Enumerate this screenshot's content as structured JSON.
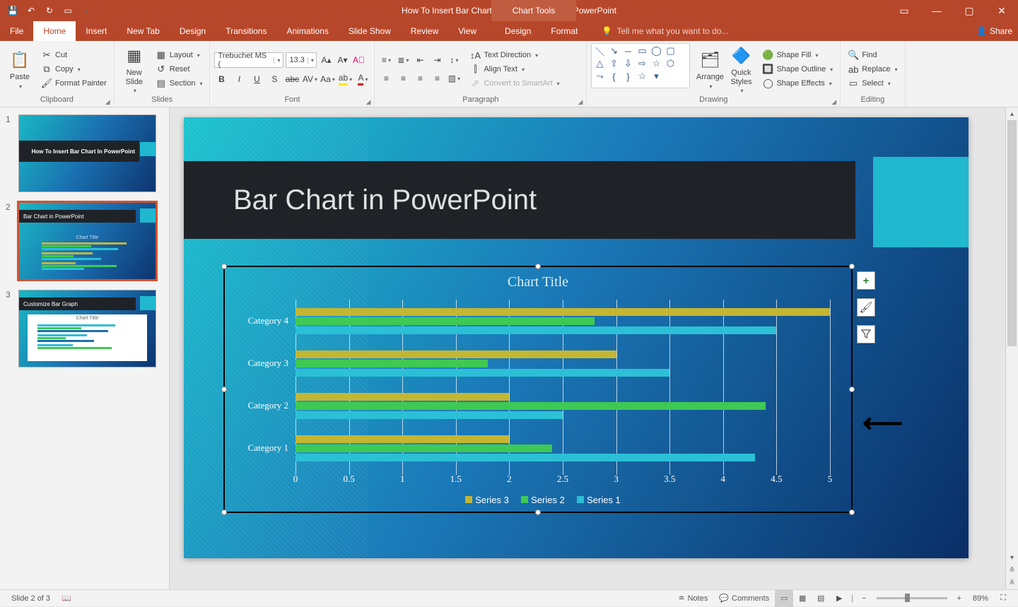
{
  "app": {
    "doc_title": "How To Insert Bar Chart In PowerPoint.pptx - PowerPoint",
    "contextual_tab_group": "Chart Tools",
    "share": "Share",
    "tell_me": "Tell me what you want to do..."
  },
  "tabs": [
    "File",
    "Home",
    "Insert",
    "New Tab",
    "Design",
    "Transitions",
    "Animations",
    "Slide Show",
    "Review",
    "View",
    "Design",
    "Format"
  ],
  "active_tab": 1,
  "ribbon": {
    "clipboard": {
      "label": "Clipboard",
      "paste": "Paste",
      "cut": "Cut",
      "copy": "Copy",
      "format_painter": "Format Painter"
    },
    "slides": {
      "label": "Slides",
      "new_slide": "New\nSlide",
      "layout": "Layout",
      "reset": "Reset",
      "section": "Section"
    },
    "font": {
      "label": "Font",
      "font_name": "Trebuchet MS (",
      "font_size": "13.3"
    },
    "paragraph": {
      "label": "Paragraph",
      "text_direction": "Text Direction",
      "align_text": "Align Text",
      "convert_smartart": "Convert to SmartArt"
    },
    "drawing": {
      "label": "Drawing",
      "arrange": "Arrange",
      "quick_styles": "Quick\nStyles",
      "shape_fill": "Shape Fill",
      "shape_outline": "Shape Outline",
      "shape_effects": "Shape Effects"
    },
    "editing": {
      "label": "Editing",
      "find": "Find",
      "replace": "Replace",
      "select": "Select"
    }
  },
  "thumbnails": [
    {
      "title": "How To Insert Bar Chart In PowerPoint"
    },
    {
      "title": "Bar Chart in PowerPoint"
    },
    {
      "title": "Customize Bar Graph"
    }
  ],
  "selected_thumb": 1,
  "slide": {
    "title": "Bar Chart in PowerPoint"
  },
  "chart_data": {
    "type": "bar",
    "title": "Chart Title",
    "xlabel": "",
    "ylabel": "",
    "xlim": [
      0,
      5
    ],
    "x_ticks": [
      0,
      0.5,
      1,
      1.5,
      2,
      2.5,
      3,
      3.5,
      4,
      4.5,
      5
    ],
    "categories": [
      "Category 4",
      "Category 3",
      "Category 2",
      "Category 1"
    ],
    "series": [
      {
        "name": "Series 3",
        "color": "#c4b632",
        "values": [
          5.0,
          3.0,
          2.0,
          2.0
        ]
      },
      {
        "name": "Series 2",
        "color": "#3ec954",
        "values": [
          2.8,
          1.8,
          4.4,
          2.4
        ]
      },
      {
        "name": "Series 1",
        "color": "#2bc0d6",
        "values": [
          4.5,
          3.5,
          2.5,
          4.3
        ]
      }
    ]
  },
  "chart_side": {
    "add": "+",
    "style": "brush",
    "filter": "funnel"
  },
  "status": {
    "slide_indicator": "Slide 2 of 3",
    "notes": "Notes",
    "comments": "Comments",
    "zoom": "89%"
  }
}
